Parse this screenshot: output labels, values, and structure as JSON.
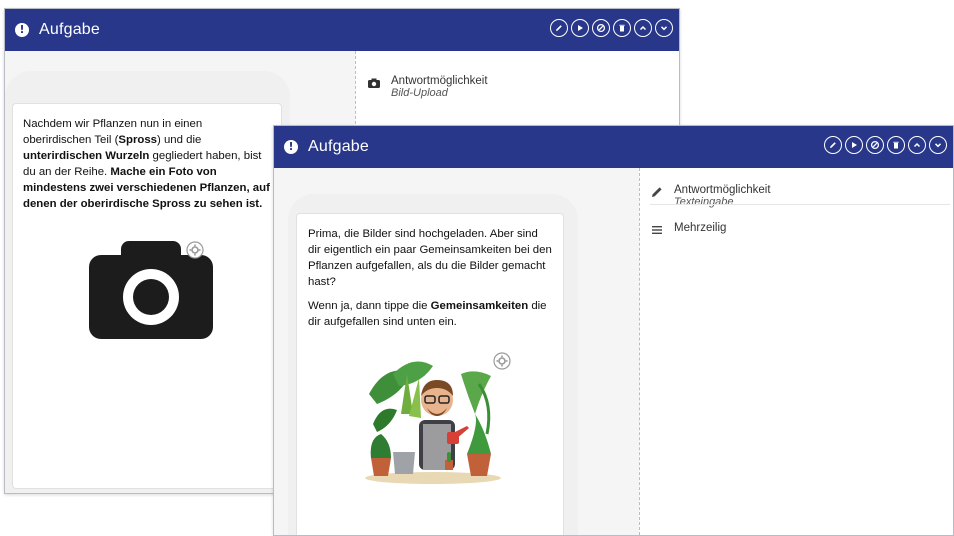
{
  "panel1": {
    "title": "Aufgabe",
    "answer_label": "Antwortmöglichkeit",
    "answer_type": "Bild-Upload",
    "text": {
      "p1": "Nachdem wir Pflanzen nun in einen oberirdischen Teil (",
      "p1_b1": "Spross",
      "p1_2": ") und die ",
      "p1_b2": "unterirdischen Wurzeln",
      "p1_3": " gegliedert haben, bist du an der Reihe. ",
      "p1_b3": "Mache ein Foto von mindestens zwei verschiedenen Pflanzen, auf denen der oberirdische Spross zu sehen ist."
    }
  },
  "panel2": {
    "title": "Aufgabe",
    "answer_label": "Antwortmöglichkeit",
    "answer_type": "Texteingabe",
    "option_label": "Mehrzeilig",
    "text": {
      "p1": "Prima, die Bilder sind hochgeladen. Aber sind dir eigentlich ein paar Gemeinsamkeiten bei den Pflanzen aufgefallen, als du die Bilder gemacht hast?",
      "p2_1": "Wenn ja, dann tippe die ",
      "p2_b": "Gemeinsamkeiten",
      "p2_2": " die dir aufgefallen sind unten ein."
    }
  },
  "icons": {
    "toolbar": [
      "pencil-icon",
      "play-icon",
      "stamp-icon",
      "trash-icon",
      "chevron-up-icon",
      "chevron-down-icon"
    ],
    "alert": "!"
  },
  "colors": {
    "header": "#28378a",
    "background": "#f5f5f5"
  }
}
